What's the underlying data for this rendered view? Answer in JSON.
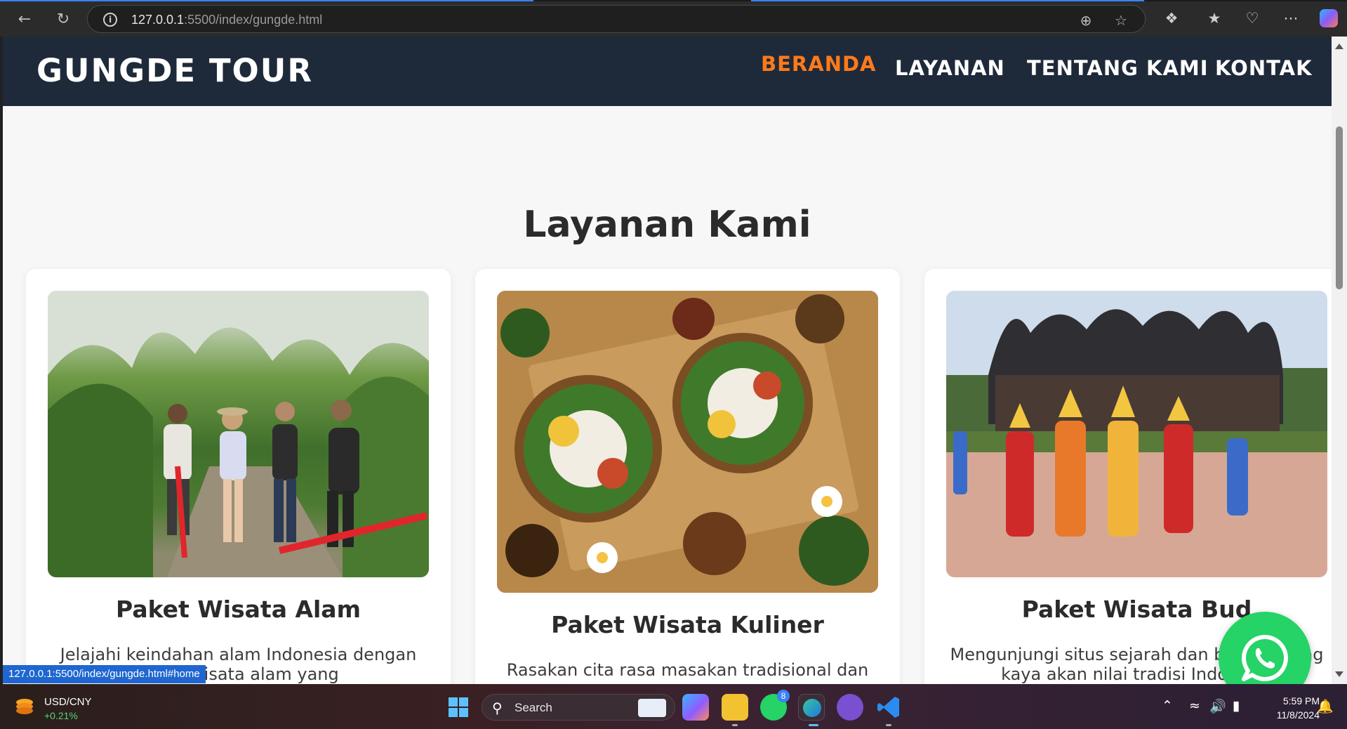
{
  "browser": {
    "url_host": "127.0.0.1",
    "url_rest": ":5500/index/gungde.html"
  },
  "site": {
    "logo": "GUNGDE TOUR",
    "menu": [
      "BERANDA",
      "LAYANAN",
      "TENTANG KAMI",
      "KONTAK"
    ],
    "active_menu": "BERANDA",
    "accent_color": "#ff7a1a",
    "header_color": "#1e2a3a"
  },
  "section": {
    "title": "Layanan Kami",
    "cards": [
      {
        "title": "Paket Wisata Alam",
        "desc_line1": "Jelajahi keindahan alam Indonesia dengan",
        "desc_line2": "paket wisata alam yang",
        "image": "nature-hike-photo"
      },
      {
        "title": "Paket Wisata Kuliner",
        "desc_line1": "Rasakan cita rasa masakan tradisional dan",
        "desc_line2": "",
        "image": "balinese-food-photo"
      },
      {
        "title": "Paket Wisata Bud",
        "desc_line1": "Mengunjungi situs sejarah dan budaya yang",
        "desc_line2": "kaya akan nilai tradisi Indonesia",
        "image": "minang-culture-photo"
      }
    ]
  },
  "status_url": "127.0.0.1:5500/index/gungde.html#home",
  "taskbar": {
    "widget_title": "USD/CNY",
    "widget_change": "+0.21%",
    "search_label": "Search",
    "whatsapp_badge": "8",
    "time": "5:59 PM",
    "date": "11/8/2024"
  }
}
